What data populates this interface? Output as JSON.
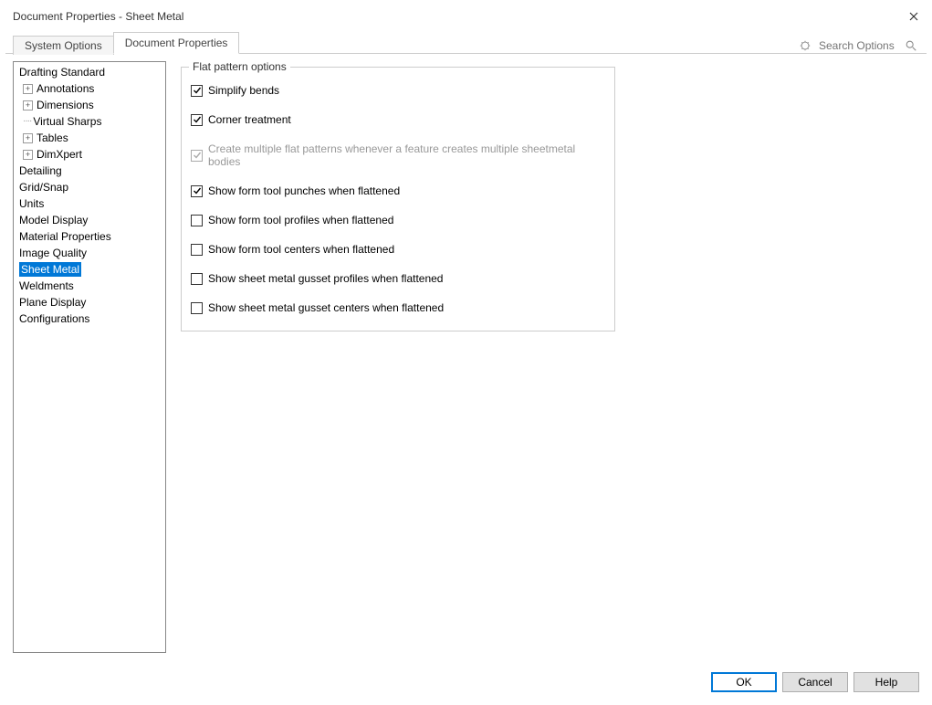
{
  "window": {
    "title": "Document Properties - Sheet Metal"
  },
  "tabs": {
    "system": "System Options",
    "document": "Document Properties"
  },
  "search": {
    "placeholder": "Search Options"
  },
  "tree": {
    "drafting": "Drafting Standard",
    "annotations": "Annotations",
    "dimensions": "Dimensions",
    "virtual_sharps": "Virtual Sharps",
    "tables": "Tables",
    "dimxpert": "DimXpert",
    "detailing": "Detailing",
    "grid_snap": "Grid/Snap",
    "units": "Units",
    "model_display": "Model Display",
    "material_properties": "Material Properties",
    "image_quality": "Image Quality",
    "sheet_metal": "Sheet Metal",
    "weldments": "Weldments",
    "plane_display": "Plane Display",
    "configurations": "Configurations"
  },
  "group": {
    "title": "Flat pattern options"
  },
  "options": {
    "simplify_bends": "Simplify bends",
    "corner_treatment": "Corner treatment",
    "multi_flat": "Create multiple flat patterns whenever a feature creates multiple sheetmetal bodies",
    "show_punches": "Show form tool punches when flattened",
    "show_profiles": "Show form tool profiles when flattened",
    "show_centers": "Show form tool centers when flattened",
    "gusset_profiles": "Show sheet metal gusset profiles when flattened",
    "gusset_centers": "Show sheet metal gusset centers when flattened"
  },
  "footer": {
    "ok": "OK",
    "cancel": "Cancel",
    "help": "Help"
  }
}
